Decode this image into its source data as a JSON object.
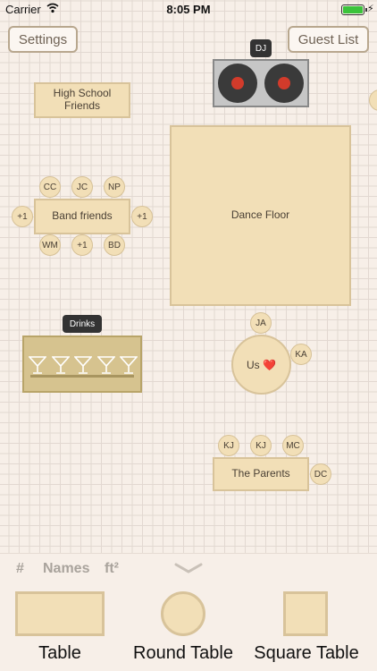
{
  "status": {
    "carrier": "Carrier",
    "time": "8:05 PM"
  },
  "toolbar": {
    "settings_label": "Settings",
    "guest_list_label": "Guest List"
  },
  "labels": {
    "dj": "DJ",
    "drinks": "Drinks"
  },
  "tables": {
    "high_school": "High School Friends",
    "band": "Band friends",
    "dance_floor": "Dance Floor",
    "us": "Us ❤️",
    "parents": "The Parents"
  },
  "seats": {
    "band_top": [
      "CC",
      "JC",
      "NP"
    ],
    "band_left": "+1",
    "band_right": "+1",
    "band_bottom": [
      "WM",
      "+1",
      "BD"
    ],
    "us_top": "JA",
    "us_right": "KA",
    "parents_top": [
      "KJ",
      "KJ",
      "MC"
    ],
    "parents_right": "DC"
  },
  "panel": {
    "tabs": [
      "#",
      "Names",
      "ft²"
    ],
    "tools": [
      "Table",
      "Round Table",
      "Square Table"
    ]
  },
  "icons": [
    "wifi-icon",
    "battery-icon",
    "chevron-down-icon",
    "glass-icon"
  ],
  "colors": {
    "table_fill": "#f2dfb7",
    "table_border": "#d8c39a",
    "grid": "#e2d8d1",
    "battery": "#3bc33b"
  }
}
